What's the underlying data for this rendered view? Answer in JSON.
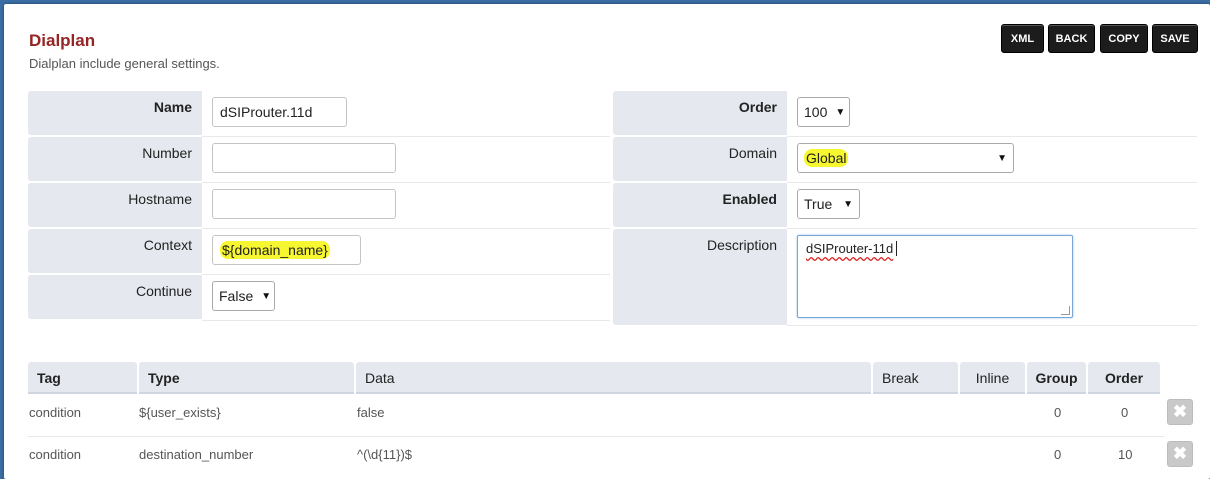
{
  "header": {
    "title": "Dialplan",
    "description": "Dialplan include general settings."
  },
  "toolbar": {
    "xml_label": "XML",
    "back_label": "BACK",
    "copy_label": "COPY",
    "save_label": "SAVE"
  },
  "form": {
    "name": {
      "label": "Name",
      "value": "dSIProuter.11d"
    },
    "number": {
      "label": "Number",
      "value": ""
    },
    "hostname": {
      "label": "Hostname",
      "value": ""
    },
    "context": {
      "label": "Context",
      "value": "${domain_name}"
    },
    "continue": {
      "label": "Continue",
      "value": "False"
    },
    "order": {
      "label": "Order",
      "value": "100"
    },
    "domain": {
      "label": "Domain",
      "value": "Global"
    },
    "enabled": {
      "label": "Enabled",
      "value": "True"
    },
    "description": {
      "label": "Description",
      "value": "dSIProuter-11d"
    }
  },
  "details": {
    "headers": {
      "tag": "Tag",
      "type": "Type",
      "data": "Data",
      "break": "Break",
      "inline": "Inline",
      "group": "Group",
      "order": "Order"
    },
    "rows": [
      {
        "tag": "condition",
        "type": "${user_exists}",
        "data": "false",
        "group": "0",
        "order": "0"
      },
      {
        "tag": "condition",
        "type": "destination_number",
        "data": "^(\\d{11})$",
        "group": "0",
        "order": "10"
      }
    ]
  },
  "icons": {
    "delete": "close-x-icon",
    "dropdown": "caret-down-icon"
  },
  "colors": {
    "title": "#952424",
    "highlight": "#f6f631",
    "label_bg": "#e5e9ef",
    "button_bg": "#1c1c1c"
  }
}
